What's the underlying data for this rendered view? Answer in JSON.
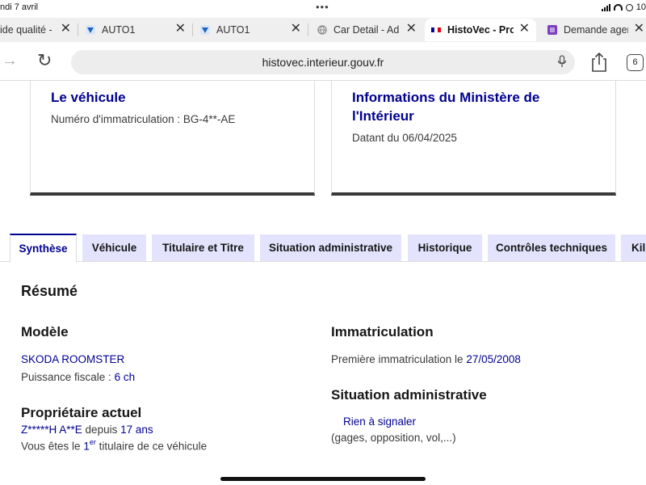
{
  "status_bar": {
    "date": "ndi 7 avril",
    "battery_text": "10"
  },
  "browser_tabs": [
    {
      "title": "ide qualité -",
      "favicon": "doc-icon"
    },
    {
      "title": "AUTO1",
      "favicon": "auto1-icon"
    },
    {
      "title": "AUTO1",
      "favicon": "auto1-icon"
    },
    {
      "title": "Car Detail - Ad",
      "favicon": "globe-icon"
    },
    {
      "title": "HistoVec - Prop",
      "favicon": "french-flag-icon",
      "active": true
    },
    {
      "title": "Demande agen",
      "favicon": "form-icon"
    }
  ],
  "address_bar": {
    "url": "histovec.interieur.gouv.fr",
    "tab_count": "6"
  },
  "card_vehicle": {
    "title": "Le véhicule",
    "plate_label": "Numéro d'immatriculation : ",
    "plate_value": "BG-4**-AE"
  },
  "card_ministry": {
    "title_line1": "Informations du Ministère de",
    "title_line2": "l'Intérieur",
    "date_label": "Datant du ",
    "date_value": "06/04/2025"
  },
  "content_tabs": [
    "Synthèse",
    "Véhicule",
    "Titulaire et Titre",
    "Situation administrative",
    "Historique",
    "Contrôles techniques",
    "Kil"
  ],
  "summary": {
    "heading": "Résumé",
    "model": {
      "heading": "Modèle",
      "name": "SKODA ROOMSTER",
      "power_label": "Puissance fiscale : ",
      "power_value": "6 ch"
    },
    "owner": {
      "heading": "Propriétaire actuel",
      "name": "Z*****H A**E",
      "since_label": " depuis ",
      "since_value": "17 ans",
      "rank_prefix": "Vous êtes le ",
      "rank_number": "1",
      "rank_sup": "er",
      "rank_suffix": " titulaire de ce véhicule"
    },
    "registration": {
      "heading": "Immatriculation",
      "first_label": "Première immatriculation le ",
      "first_value": "27/05/2008"
    },
    "admin": {
      "heading": "Situation administrative",
      "status": "Rien à signaler",
      "details": "(gages, opposition, vol,...)"
    }
  },
  "colors": {
    "primary": "#000091",
    "tab_bg": "#e3e3fd",
    "text": "#161616"
  }
}
